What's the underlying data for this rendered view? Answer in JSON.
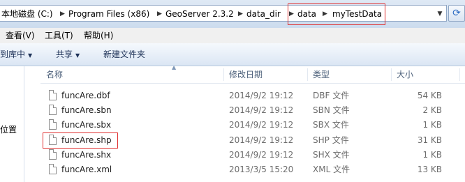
{
  "address_bar": {
    "crumbs": [
      "本地磁盘 (C:)",
      "Program Files (x86)",
      "GeoServer 2.3.2",
      "data_dir",
      "data",
      "myTestData"
    ],
    "dropdown_icon": "chevron-down-icon",
    "refresh_icon": "refresh-icon"
  },
  "menu": {
    "items": [
      "查看(V)",
      "工具(T)",
      "帮助(H)"
    ]
  },
  "toolbar": {
    "include_in_library": "到库中",
    "share": "共享",
    "new_folder": "新建文件夹"
  },
  "nav_pane": {
    "label": "位置"
  },
  "columns": {
    "name": "名称",
    "date_modified": "修改日期",
    "type": "类型",
    "size": "大小"
  },
  "files": [
    {
      "name": "funcAre.dbf",
      "date": "2014/9/2 19:12",
      "type": "DBF 文件",
      "size": "54 KB"
    },
    {
      "name": "funcAre.sbn",
      "date": "2014/9/2 19:12",
      "type": "SBN 文件",
      "size": "2 KB"
    },
    {
      "name": "funcAre.sbx",
      "date": "2014/9/2 19:12",
      "type": "SBX 文件",
      "size": "1 KB"
    },
    {
      "name": "funcAre.shp",
      "date": "2014/9/2 19:12",
      "type": "SHP 文件",
      "size": "31 KB"
    },
    {
      "name": "funcAre.shx",
      "date": "2014/9/2 19:12",
      "type": "SHX 文件",
      "size": "1 KB"
    },
    {
      "name": "funcAre.xml",
      "date": "2013/3/5 15:20",
      "type": "XML 文件",
      "size": "13 KB"
    }
  ],
  "highlight_color": "#e03030"
}
